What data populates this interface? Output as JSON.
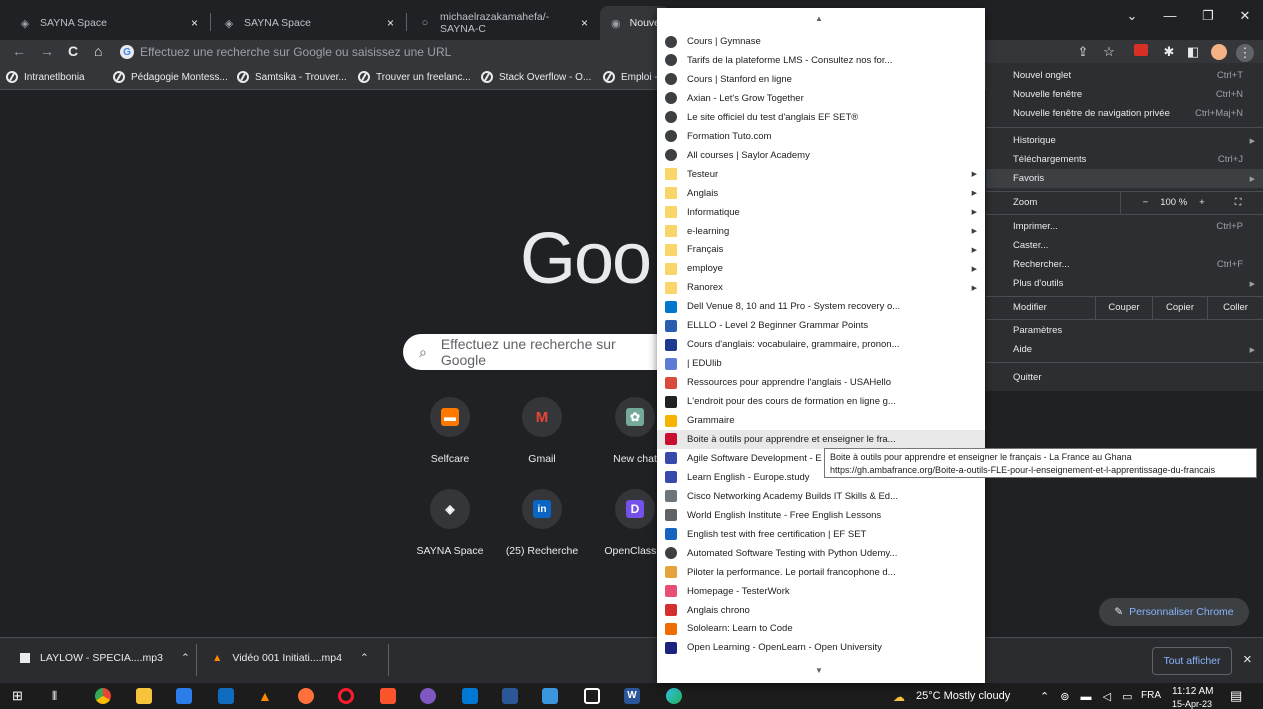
{
  "tabs": [
    {
      "title": "SAYNA Space",
      "icon": "sayna-icon",
      "close": "×"
    },
    {
      "title": "SAYNA Space",
      "icon": "sayna-icon",
      "close": "×"
    },
    {
      "title": "michaelrazakamahefa/-SAYNA-C",
      "icon": "github-icon",
      "close": "×"
    },
    {
      "title": "Nouve",
      "icon": "chrome-icon"
    }
  ],
  "window_controls": {
    "tabs_menu": "⌄",
    "minimize": "—",
    "restore": "❐",
    "close": "✕"
  },
  "toolbar": {
    "back": "←",
    "forward": "→",
    "reload": "C",
    "home": "⌂",
    "omnibox_placeholder": "Effectuez une recherche sur Google ou saisissez une URL"
  },
  "bookmarks_bar": [
    "Intranetlbonia",
    "Pédagogie Montess...",
    "Samtsika - Trouver...",
    "Trouver un freelanc...",
    "Stack Overflow - O...",
    "Emploi -"
  ],
  "ntp": {
    "logo": "Goo",
    "search_placeholder": "Effectuez une recherche sur Google",
    "shortcuts": [
      {
        "label": "Selfcare",
        "icon": "orange-icon",
        "color": "#ff7900"
      },
      {
        "label": "Gmail",
        "icon": "gmail-icon",
        "color": "#ea4335"
      },
      {
        "label": "New chat",
        "icon": "chatgpt-icon",
        "color": "#74aa9c"
      },
      {
        "label": "SAYNA Space",
        "icon": "sayna-icon",
        "color": "#3c4043"
      },
      {
        "label": "(25) Recherche",
        "icon": "linkedin-icon",
        "color": "#0a66c2"
      },
      {
        "label": "OpenClassro",
        "icon": "openclassrooms-icon",
        "color": "#7451eb"
      }
    ],
    "customize_label": "Personnaliser Chrome"
  },
  "bookmarks_menu": {
    "items": [
      {
        "label": "Cours | Gymnase",
        "type": "link",
        "icon": "globe-icon"
      },
      {
        "label": "Tarifs de la plateforme LMS - Consultez nos for...",
        "type": "link",
        "icon": "globe-icon"
      },
      {
        "label": "Cours | Stanford en ligne",
        "type": "link",
        "icon": "globe-icon"
      },
      {
        "label": "Axian - Let's Grow Together",
        "type": "link",
        "icon": "globe-icon"
      },
      {
        "label": "Le site officiel du test d'anglais EF SET®",
        "type": "link",
        "icon": "globe-icon"
      },
      {
        "label": "Formation Tuto.com",
        "type": "link",
        "icon": "globe-icon"
      },
      {
        "label": "All courses | Saylor Academy",
        "type": "link",
        "icon": "globe-icon"
      },
      {
        "label": "Testeur",
        "type": "folder",
        "icon": "folder-icon"
      },
      {
        "label": "Anglais",
        "type": "folder",
        "icon": "folder-icon"
      },
      {
        "label": "Informatique",
        "type": "folder",
        "icon": "folder-icon"
      },
      {
        "label": "e-learning",
        "type": "folder",
        "icon": "folder-icon"
      },
      {
        "label": "Français",
        "type": "folder",
        "icon": "folder-icon"
      },
      {
        "label": "employe",
        "type": "folder",
        "icon": "folder-icon"
      },
      {
        "label": "Ranorex",
        "type": "folder",
        "icon": "folder-icon"
      },
      {
        "label": "Dell Venue 8, 10 and 11 Pro - System recovery o...",
        "type": "link",
        "icon": "dell-icon",
        "color": "#0076ce"
      },
      {
        "label": "ELLLO - Level 2 Beginner Grammar Points",
        "type": "link",
        "icon": "elllo-icon",
        "color": "#2a5db0"
      },
      {
        "label": "Cours d'anglais: vocabulaire, grammaire, pronon...",
        "type": "link",
        "icon": "dash-icon",
        "color": "#1f3a93"
      },
      {
        "label": "| EDUlib",
        "type": "link",
        "icon": "edulib-icon",
        "color": "#5b7bd5"
      },
      {
        "label": "Ressources pour apprendre l'anglais - USAHello",
        "type": "link",
        "icon": "usahello-icon",
        "color": "#d84a3a"
      },
      {
        "label": "L'endroit pour des cours de formation en ligne g...",
        "type": "link",
        "icon": "l-icon",
        "color": "#202124"
      },
      {
        "label": "Grammaire",
        "type": "link",
        "icon": "grammaire-icon",
        "color": "#f4b400"
      },
      {
        "label": "Boite à outils pour apprendre et enseigner le fra...",
        "type": "link",
        "icon": "ambafrance-icon",
        "color": "#c8102e",
        "highlighted": true
      },
      {
        "label": "Agile Software Development - E",
        "type": "link",
        "icon": "agile-icon",
        "color": "#3949ab"
      },
      {
        "label": "Learn English - Europe.study",
        "type": "link",
        "icon": "europe-study-icon",
        "color": "#3949ab"
      },
      {
        "label": "Cisco Networking Academy Builds IT Skills & Ed...",
        "type": "link",
        "icon": "cisco-icon",
        "color": "#6c757d"
      },
      {
        "label": "World English Institute - Free English Lessons",
        "type": "link",
        "icon": "world-icon",
        "color": "#5f6368"
      },
      {
        "label": "English test with free certification | EF SET",
        "type": "link",
        "icon": "ef-icon",
        "color": "#1565c0"
      },
      {
        "label": "Automated Software Testing with Python Udemy...",
        "type": "link",
        "icon": "globe-icon"
      },
      {
        "label": "Piloter la performance. Le portail francophone d...",
        "type": "link",
        "icon": "piloter-icon",
        "color": "#e6a23c"
      },
      {
        "label": "Homepage - TesterWork",
        "type": "link",
        "icon": "testerwork-icon",
        "color": "#e94e77"
      },
      {
        "label": "Anglais chrono",
        "type": "link",
        "icon": "anglais-chrono-icon",
        "color": "#d32f2f"
      },
      {
        "label": "Sololearn: Learn to Code",
        "type": "link",
        "icon": "sololearn-icon",
        "color": "#ef6c00"
      },
      {
        "label": "Open Learning - OpenLearn - Open University",
        "type": "link",
        "icon": "openlearn-icon",
        "color": "#1a237e"
      }
    ],
    "scroll_up": "▲",
    "scroll_down": "▼"
  },
  "tooltip": {
    "title": "Boite à outils pour apprendre et enseigner le français - La France au Ghana",
    "url": "https://gh.ambafrance.org/Boite-a-outils-FLE-pour-l-enseignement-et-l-apprentissage-du-francais"
  },
  "chrome_menu": {
    "group1": [
      {
        "label": "Nouvel onglet",
        "shortcut": "Ctrl+T"
      },
      {
        "label": "Nouvelle fenêtre",
        "shortcut": "Ctrl+N"
      },
      {
        "label": "Nouvelle fenêtre de navigation privée",
        "shortcut": "Ctrl+Maj+N"
      }
    ],
    "group2": [
      {
        "label": "Historique",
        "submenu": true
      },
      {
        "label": "Téléchargements",
        "shortcut": "Ctrl+J"
      },
      {
        "label": "Favoris",
        "submenu": true,
        "highlighted": true
      }
    ],
    "zoom": {
      "label": "Zoom",
      "minus": "−",
      "value": "100 %",
      "plus": "+",
      "fullscreen": "⛶"
    },
    "group3": [
      {
        "label": "Imprimer...",
        "shortcut": "Ctrl+P"
      },
      {
        "label": "Caster..."
      },
      {
        "label": "Rechercher...",
        "shortcut": "Ctrl+F"
      },
      {
        "label": "Plus d'outils",
        "submenu": true
      }
    ],
    "edit": {
      "label": "Modifier",
      "cut": "Couper",
      "copy": "Copier",
      "paste": "Coller"
    },
    "group4": [
      {
        "label": "Paramètres"
      },
      {
        "label": "Aide",
        "submenu": true
      }
    ],
    "quit": "Quitter"
  },
  "downloads": {
    "items": [
      {
        "name": "LAYLOW - SPECIA....mp3",
        "icon": "audio-file-icon"
      },
      {
        "name": "Vidéo 001 Initiati....mp4",
        "icon": "vlc-icon"
      }
    ],
    "show_all": "Tout afficher",
    "close": "×"
  },
  "taskbar": {
    "weather": "25°C  Mostly cloudy",
    "language": "FRA",
    "time": "11:12 AM",
    "date": "15-Apr-23"
  }
}
